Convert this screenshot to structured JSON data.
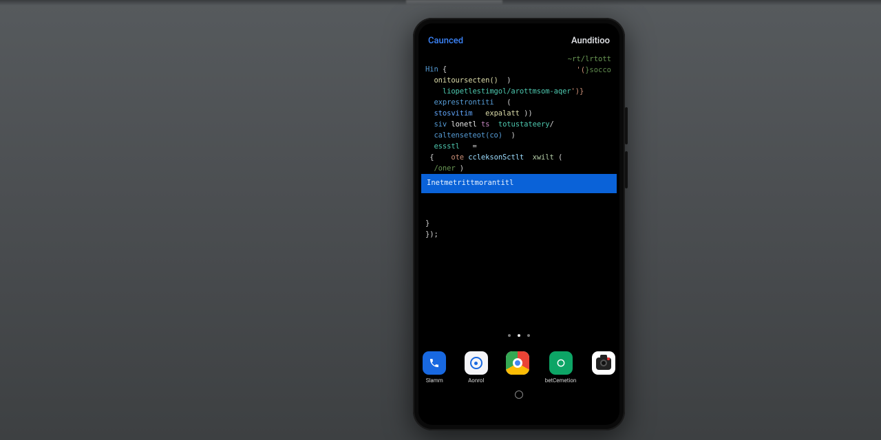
{
  "header": {
    "left": "Caunced",
    "right": "Aunditioo"
  },
  "code": {
    "l1_a": "Hin",
    "l1_b": "{",
    "l2_a": "onitoursecten()",
    "l2_b": ")",
    "l3_a": "liopetlestimgol/arottmsom-aqer",
    "l3_b": "')}",
    "l4_a": "exprestrontiti",
    "l4_b": "(",
    "l5_a": "stosvitim",
    "l5_b": "expalatt",
    "l5_c": "))",
    "l6_a": "siv",
    "l6_b": "lonetl",
    "l6_c": "ts",
    "l6_d": "totustateery",
    "l6_e": "/",
    "l7_a": "caltenseteot(co)",
    "l7_b": ")",
    "l8_a": "essstl",
    "l8_b": "=",
    "l9_a": "{",
    "l9_b": "ote",
    "l9_c": "ccleksonSctlt",
    "l9_d": "xwilt",
    "l9_e": "(",
    "l10_a": "/oner",
    "l10_b": ")",
    "l12": "}",
    "l13": "});"
  },
  "rightHints": {
    "path": "~rt/lrtott",
    "frag_a": "'(",
    "frag_b": "}socco"
  },
  "highlight": "Inetmetrittmorantitl",
  "dock": {
    "items": [
      {
        "name": "phone",
        "label": "Slamm"
      },
      {
        "name": "browser",
        "label": "Aonrol"
      },
      {
        "name": "chrome",
        "label": ""
      },
      {
        "name": "messages",
        "label": "betCemetion"
      },
      {
        "name": "camera",
        "label": ""
      }
    ]
  }
}
